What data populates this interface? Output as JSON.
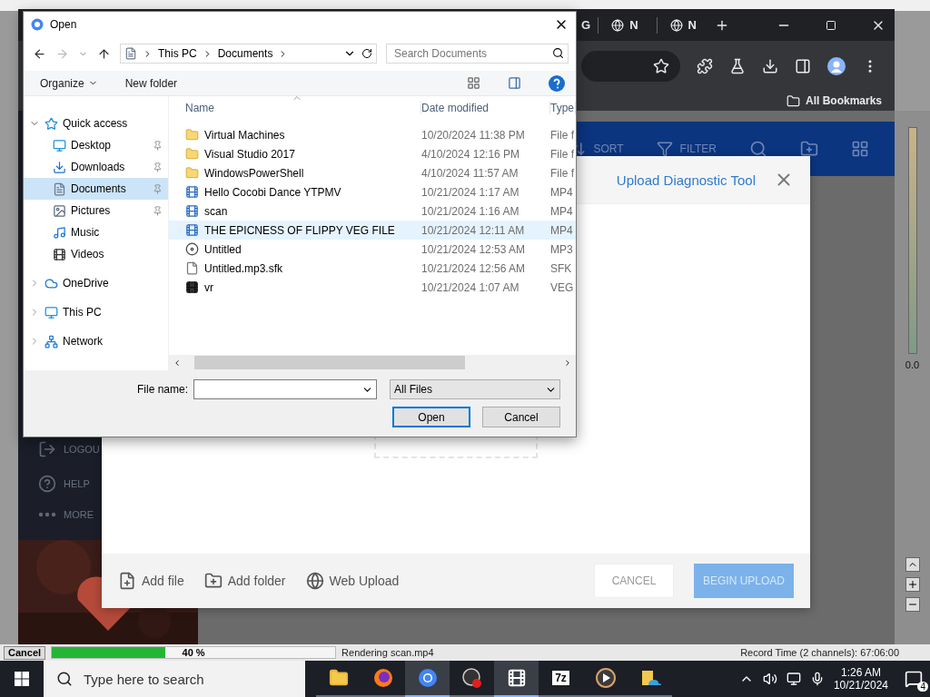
{
  "browser": {
    "tabs": [
      {
        "label": "G",
        "kind": "plain"
      },
      {
        "label": "N",
        "kind": "globe"
      },
      {
        "label": "N",
        "kind": "globe"
      }
    ],
    "bookmarks": [
      {
        "label": "All Bookmarks"
      }
    ]
  },
  "page": {
    "header": [
      {
        "label": "SORT",
        "kind": "sort"
      },
      {
        "label": "FILTER",
        "kind": "filter"
      },
      {
        "kind": "search"
      },
      {
        "kind": "folder"
      },
      {
        "kind": "grid"
      }
    ],
    "sidebar": [
      {
        "label": "LOGOU",
        "kind": "logout"
      },
      {
        "label": "HELP",
        "kind": "help"
      },
      {
        "label": "MORE",
        "kind": "more"
      }
    ]
  },
  "upload": {
    "title": "Upload Diagnostic Tool",
    "actions": [
      {
        "label": "Add file",
        "kind": "file"
      },
      {
        "label": "Add folder",
        "kind": "folder"
      },
      {
        "label": "Web Upload",
        "kind": "web"
      }
    ],
    "cancel": "CANCEL",
    "submit": {
      "label": "BEGIN UPLOAD",
      "disabled": true
    }
  },
  "dialog": {
    "title": "Open",
    "path": [
      "This PC",
      "Documents"
    ],
    "search": {
      "placeholder": "Search Documents"
    },
    "toolbar": [
      "Organize",
      "New folder"
    ],
    "nav": [
      {
        "label": "Quick access",
        "kind": "star",
        "expanded": true,
        "children": [
          {
            "label": "Desktop",
            "kind": "desktop",
            "pinned": true,
            "selected": false
          },
          {
            "label": "Downloads",
            "kind": "download",
            "pinned": true,
            "selected": false
          },
          {
            "label": "Documents",
            "kind": "document",
            "pinned": true,
            "selected": true
          },
          {
            "label": "Pictures",
            "kind": "picture",
            "pinned": true,
            "selected": false
          },
          {
            "label": "Music",
            "kind": "music",
            "pinned": false,
            "selected": false
          },
          {
            "label": "Videos",
            "kind": "video",
            "pinned": false,
            "selected": false
          }
        ]
      },
      {
        "label": "OneDrive",
        "kind": "cloud",
        "expanded": false
      },
      {
        "label": "This PC",
        "kind": "pc",
        "expanded": false
      },
      {
        "label": "Network",
        "kind": "network",
        "expanded": false
      }
    ],
    "columns": [
      "Name",
      "Date modified",
      "Type"
    ],
    "files": [
      {
        "name": "Virtual Machines",
        "date": "10/20/2024 11:38 PM",
        "type": "File f",
        "kind": "folder",
        "hovered": false
      },
      {
        "name": "Visual Studio 2017",
        "date": "4/10/2024 12:16 PM",
        "type": "File f",
        "kind": "folder",
        "hovered": false
      },
      {
        "name": "WindowsPowerShell",
        "date": "4/10/2024 11:57 AM",
        "type": "File f",
        "kind": "folder",
        "hovered": false
      },
      {
        "name": "Hello Cocobi Dance YTPMV",
        "date": "10/21/2024 1:17 AM",
        "type": "MP4",
        "kind": "video",
        "hovered": false
      },
      {
        "name": "scan",
        "date": "10/21/2024 1:16 AM",
        "type": "MP4",
        "kind": "video",
        "hovered": false
      },
      {
        "name": "THE EPICNESS OF FLIPPY VEG FILE",
        "date": "10/21/2024 12:11 AM",
        "type": "MP4",
        "kind": "video",
        "hovered": true
      },
      {
        "name": "Untitled",
        "date": "10/21/2024 12:53 AM",
        "type": "MP3",
        "kind": "audio",
        "hovered": false
      },
      {
        "name": "Untitled.mp3.sfk",
        "date": "10/21/2024 12:56 AM",
        "type": "SFK",
        "kind": "file",
        "hovered": false
      },
      {
        "name": "vr",
        "date": "10/21/2024 1:07 AM",
        "type": "VEG",
        "kind": "veg",
        "hovered": false
      }
    ],
    "file_name_label": "File name:",
    "filter": "All Files",
    "open": "Open",
    "cancel": "Cancel"
  },
  "meter": {
    "reading": "0.0"
  },
  "status_bar": {
    "cancel": "Cancel",
    "progress": {
      "level": 0.4,
      "text": "40 %"
    },
    "message": "Rendering scan.mp4",
    "record_time": "Record Time (2 channels): 67:06:00"
  },
  "taskbar": {
    "search": {
      "placeholder": "Type here to search"
    },
    "apps": [
      {
        "kind": "explorer",
        "active": false
      },
      {
        "kind": "firefox",
        "active": false
      },
      {
        "kind": "chrome",
        "active": true
      },
      {
        "kind": "recorder",
        "active": false
      },
      {
        "kind": "vegas",
        "active": true
      },
      {
        "kind": "sevenzip",
        "label": "7z",
        "active": false
      },
      {
        "kind": "player",
        "active": false
      },
      {
        "kind": "onedrive",
        "active": false
      }
    ],
    "time": "1:26 AM",
    "date": "10/21/2024",
    "notifications": "4"
  }
}
